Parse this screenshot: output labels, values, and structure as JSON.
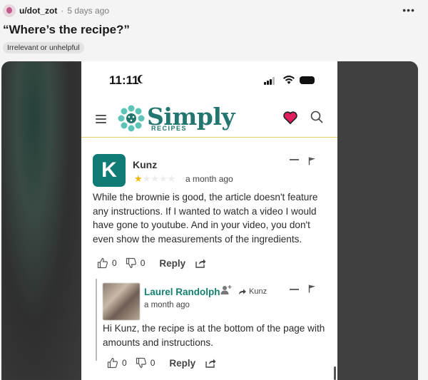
{
  "post": {
    "username": "u/dot_zot",
    "separator": "·",
    "timestamp": "5 days ago",
    "more": "•••",
    "title": "“Where’s the recipe?”",
    "flair": "Irrelevant or unhelpful"
  },
  "phone": {
    "time": "11:11",
    "logo_text": "Simply",
    "logo_sub": "RECIPES"
  },
  "comment": {
    "avatar_letter": "K",
    "author": "Kunz",
    "rating_filled": 1,
    "rating_total": 5,
    "age": "a month ago",
    "body": "While the brownie is good, the article doesn't feature any instructions. If I wanted to watch a video I would have gone to youtube. And in your video, you don't even show the measurements of the ingredients.",
    "likes": "0",
    "dislikes": "0",
    "reply_label": "Reply"
  },
  "reply": {
    "author": "Laurel Randolph",
    "reply_to": "Kunz",
    "age": "a month ago",
    "body": "Hi Kunz, the recipe is at the bottom of the page with amounts and instructions.",
    "likes": "0",
    "dislikes": "0",
    "reply_label": "Reply"
  },
  "colors": {
    "brand_teal": "#23766f",
    "avatar_teal": "#107a74",
    "star": "#f2b705",
    "reply_author": "#15806f",
    "nav_divider": "#e6cf6d",
    "heart": "#e01f5c"
  }
}
